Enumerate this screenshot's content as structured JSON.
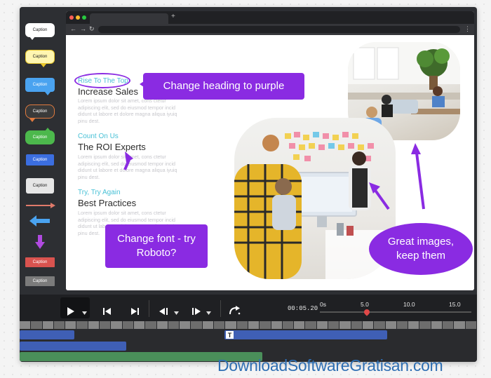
{
  "palette": {
    "captions": [
      "Caption",
      "Caption",
      "Caption",
      "Caption",
      "Caption",
      "Caption",
      "Caption",
      "Caption",
      "Caption"
    ]
  },
  "browser": {
    "tab_add": "+",
    "nav": {
      "back": "←",
      "forward": "→",
      "reload": "↻",
      "menu": "⋮"
    }
  },
  "slide": {
    "sections": [
      {
        "tag": "Rise To The Top",
        "title": "Increase Sales",
        "body": "Lorem ipsum dolor sit amet, cons ctetur adipiscing elit, sed do eiusmod tempor incid didunt ut labore et dolore magna aliqua iyuiq pinu dest."
      },
      {
        "tag": "Count On Us",
        "title": "The ROI Experts",
        "body": "Lorem ipsum dolor sit amet, cons ctetur adipiscing elit, sed do eiusmod tempor incid didunt ut labore et dolore magna aliqua iyuiq pinu dest."
      },
      {
        "tag": "Try, Try Again",
        "title": "Best Practices",
        "body": "Lorem ipsum dolor sit amet, cons ctetur adipiscing elit, sed do eiusmod tempor incid didunt ut labore et dolore magna aliqua iyuiq pinu dest."
      }
    ],
    "callouts": {
      "heading": "Change heading to purple",
      "font": "Change font - try Roboto?",
      "images": "Great images, keep them"
    }
  },
  "controls": {
    "time": "00:05.20",
    "ticks": [
      "0s",
      "5.0",
      "10.0",
      "15.0"
    ],
    "playhead_seconds": 5.0
  },
  "timeline": {
    "text_clip_label": "T"
  },
  "watermark": "DownloadSoftwareGratisan.com",
  "colors": {
    "accent": "#8a2be2",
    "tag": "#49c1d6",
    "track_blue": "#3f5fb5",
    "track_green": "#4a8f5a",
    "playhead": "#e04848"
  }
}
